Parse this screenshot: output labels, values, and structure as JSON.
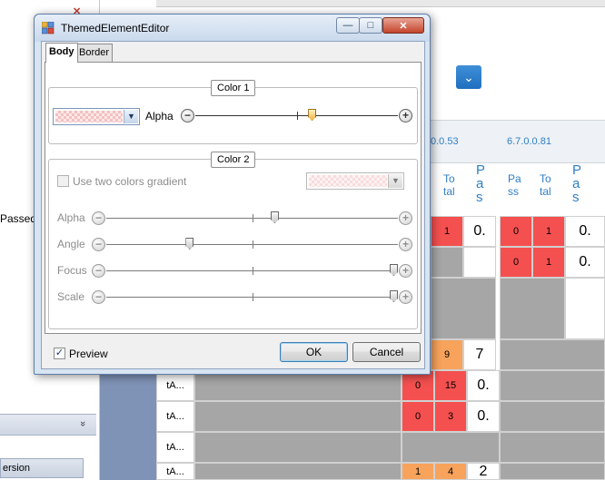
{
  "background": {
    "left_items": [
      "Passed"
    ],
    "version_label": "ersion",
    "chevron": "»",
    "dropdown_icon": "chevron-down-icon",
    "versions": [
      "0.0.53",
      "6.7.0.0.81"
    ],
    "col_headers": [
      {
        "pass": "Pa\nss",
        "total": "To\ntal",
        "p": "P\na\ns"
      },
      {
        "pass": "Pa\nss",
        "total": "To\ntal",
        "p": "P\na\ns"
      }
    ],
    "row_labels": [
      "tA...",
      "tA...",
      "tA...",
      "tA..."
    ],
    "cells": {
      "r1_total": "1",
      "r1_pct": "0.",
      "r2_pass": "0",
      "r2_total": "1",
      "r2_pct": "0.",
      "r1b_pass": "0",
      "r1b_total": "1",
      "r1b_pct": "0.",
      "r3_total": "9",
      "r3_pct": "7",
      "r4_pass": "0",
      "r4_total": "15",
      "r4_pct": "0.",
      "r5_pass": "0",
      "r5_total": "3",
      "r5_pct": "0.",
      "r7_pass": "1",
      "r7_total": "4",
      "r7_pct": "2"
    }
  },
  "dialog": {
    "title": "ThemedElementEditor",
    "controls": {
      "minimize": "—",
      "maximize": "□",
      "close": "✕"
    },
    "tabs": [
      {
        "label": "Body",
        "active": true
      },
      {
        "label": "Border",
        "active": false
      }
    ],
    "color1": {
      "group_title": "Color 1",
      "alpha_label": "Alpha",
      "alpha_value": 0.58
    },
    "color2": {
      "group_title": "Color 2",
      "gradient_checkbox_label": "Use two colors gradient",
      "gradient_checked": false,
      "sliders": [
        {
          "label": "Alpha",
          "value": 0.58
        },
        {
          "label": "Angle",
          "value": 0.28
        },
        {
          "label": "Focus",
          "value": 1.0
        },
        {
          "label": "Scale",
          "value": 1.0
        }
      ]
    },
    "preview_label": "Preview",
    "preview_checked": true,
    "ok_label": "OK",
    "cancel_label": "Cancel",
    "accent_color": "#f0b640"
  }
}
